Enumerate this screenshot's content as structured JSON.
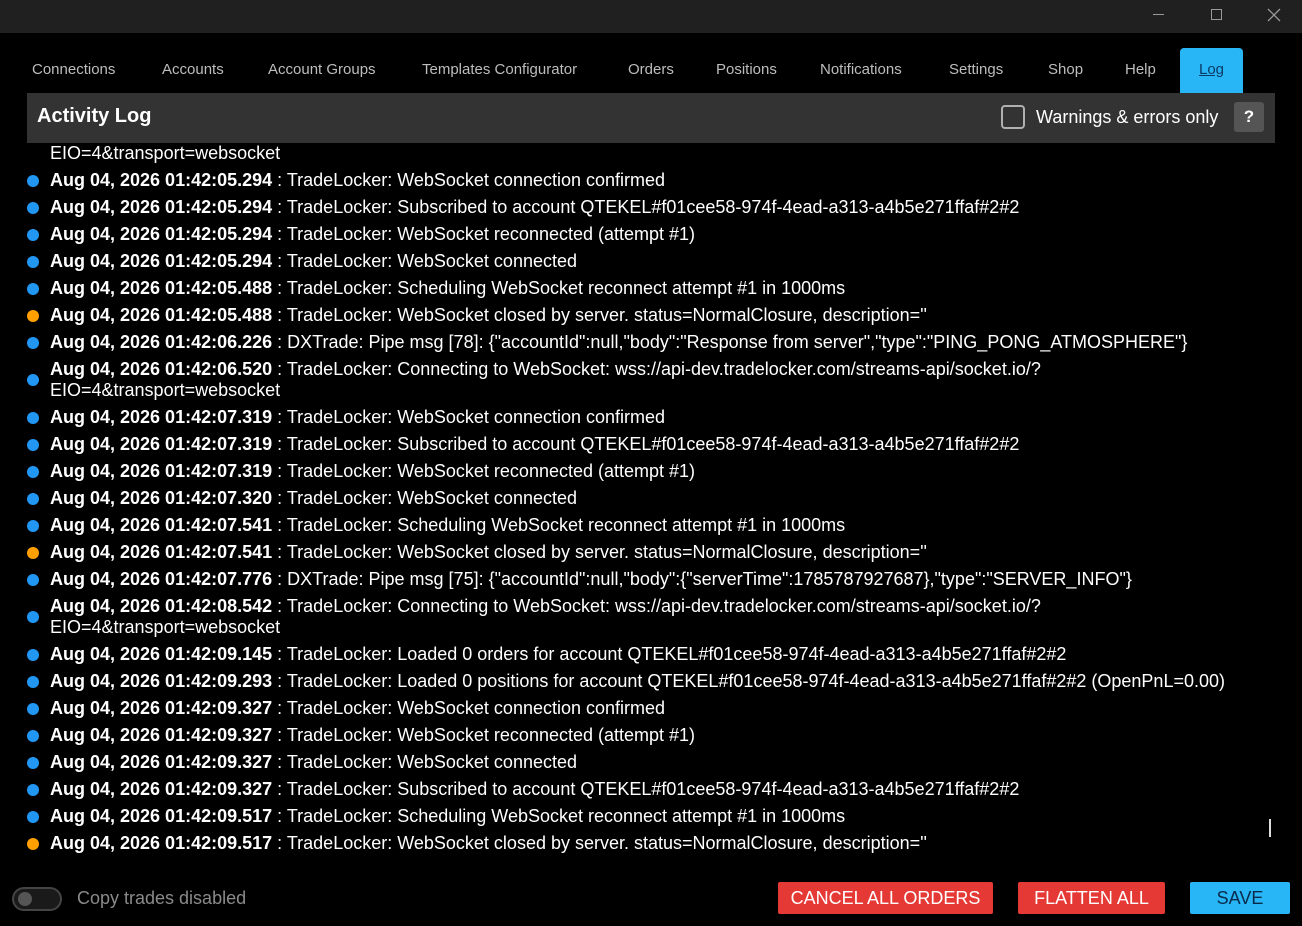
{
  "tabs": [
    {
      "label": "Connections"
    },
    {
      "label": "Accounts"
    },
    {
      "label": "Account Groups"
    },
    {
      "label": "Templates Configurator"
    },
    {
      "label": "Orders"
    },
    {
      "label": "Positions"
    },
    {
      "label": "Notifications"
    },
    {
      "label": "Settings"
    },
    {
      "label": "Shop"
    },
    {
      "label": "Help"
    },
    {
      "label": "Log"
    }
  ],
  "header": {
    "title": "Activity Log",
    "filter_label": "Warnings & errors only",
    "help_label": "?"
  },
  "colors": {
    "info_dot": "#2196f3",
    "warn_dot": "#ffa000",
    "accent": "#29b6f6",
    "danger": "#e53935"
  },
  "log": {
    "entries": [
      {
        "level": "cont",
        "ts": "",
        "msg": "EIO=4&transport=websocket"
      },
      {
        "level": "info",
        "ts": "Aug 04, 2026 01:42:05.294",
        "msg": " : TradeLocker: WebSocket connection confirmed"
      },
      {
        "level": "info",
        "ts": "Aug 04, 2026 01:42:05.294",
        "msg": " : TradeLocker: Subscribed to account QTEKEL#f01cee58-974f-4ead-a313-a4b5e271ffaf#2#2"
      },
      {
        "level": "info",
        "ts": "Aug 04, 2026 01:42:05.294",
        "msg": " : TradeLocker: WebSocket reconnected (attempt #1)"
      },
      {
        "level": "info",
        "ts": "Aug 04, 2026 01:42:05.294",
        "msg": " : TradeLocker: WebSocket connected"
      },
      {
        "level": "info",
        "ts": "Aug 04, 2026 01:42:05.488",
        "msg": " : TradeLocker: Scheduling WebSocket reconnect attempt #1 in 1000ms"
      },
      {
        "level": "warn",
        "ts": "Aug 04, 2026 01:42:05.488",
        "msg": " : TradeLocker: WebSocket closed by server. status=NormalClosure, description=''"
      },
      {
        "level": "info",
        "ts": "Aug 04, 2026 01:42:06.226",
        "msg": " : DXTrade: Pipe msg [78]: {\"accountId\":null,\"body\":\"Response from server\",\"type\":\"PING_PONG_ATMOSPHERE\"}"
      },
      {
        "level": "info-wrap",
        "ts": "Aug 04, 2026 01:42:06.520",
        "msg": " : TradeLocker: Connecting to WebSocket: wss://api-dev.tradelocker.com/streams-api/socket.io/? EIO=4&transport=websocket"
      },
      {
        "level": "info",
        "ts": "Aug 04, 2026 01:42:07.319",
        "msg": " : TradeLocker: WebSocket connection confirmed"
      },
      {
        "level": "info",
        "ts": "Aug 04, 2026 01:42:07.319",
        "msg": " : TradeLocker: Subscribed to account QTEKEL#f01cee58-974f-4ead-a313-a4b5e271ffaf#2#2"
      },
      {
        "level": "info",
        "ts": "Aug 04, 2026 01:42:07.319",
        "msg": " : TradeLocker: WebSocket reconnected (attempt #1)"
      },
      {
        "level": "info",
        "ts": "Aug 04, 2026 01:42:07.320",
        "msg": " : TradeLocker: WebSocket connected"
      },
      {
        "level": "info",
        "ts": "Aug 04, 2026 01:42:07.541",
        "msg": " : TradeLocker: Scheduling WebSocket reconnect attempt #1 in 1000ms"
      },
      {
        "level": "warn",
        "ts": "Aug 04, 2026 01:42:07.541",
        "msg": " : TradeLocker: WebSocket closed by server. status=NormalClosure, description=''"
      },
      {
        "level": "info",
        "ts": "Aug 04, 2026 01:42:07.776",
        "msg": " : DXTrade: Pipe msg [75]: {\"accountId\":null,\"body\":{\"serverTime\":1785787927687},\"type\":\"SERVER_INFO\"}"
      },
      {
        "level": "info-wrap",
        "ts": "Aug 04, 2026 01:42:08.542",
        "msg": " : TradeLocker: Connecting to WebSocket: wss://api-dev.tradelocker.com/streams-api/socket.io/? EIO=4&transport=websocket"
      },
      {
        "level": "info",
        "ts": "Aug 04, 2026 01:42:09.145",
        "msg": " : TradeLocker: Loaded 0 orders for account QTEKEL#f01cee58-974f-4ead-a313-a4b5e271ffaf#2#2"
      },
      {
        "level": "info",
        "ts": "Aug 04, 2026 01:42:09.293",
        "msg": " : TradeLocker: Loaded 0 positions for account QTEKEL#f01cee58-974f-4ead-a313-a4b5e271ffaf#2#2 (OpenPnL=0.00)"
      },
      {
        "level": "info",
        "ts": "Aug 04, 2026 01:42:09.327",
        "msg": " : TradeLocker: WebSocket connection confirmed"
      },
      {
        "level": "info",
        "ts": "Aug 04, 2026 01:42:09.327",
        "msg": " : TradeLocker: WebSocket reconnected (attempt #1)"
      },
      {
        "level": "info",
        "ts": "Aug 04, 2026 01:42:09.327",
        "msg": " : TradeLocker: WebSocket connected"
      },
      {
        "level": "info",
        "ts": "Aug 04, 2026 01:42:09.327",
        "msg": " : TradeLocker: Subscribed to account QTEKEL#f01cee58-974f-4ead-a313-a4b5e271ffaf#2#2"
      },
      {
        "level": "info",
        "ts": "Aug 04, 2026 01:42:09.517",
        "msg": " : TradeLocker: Scheduling WebSocket reconnect attempt #1 in 1000ms"
      },
      {
        "level": "warn",
        "ts": "Aug 04, 2026 01:42:09.517",
        "msg": " : TradeLocker: WebSocket closed by server. status=NormalClosure, description=''"
      }
    ]
  },
  "footer": {
    "copy_trades_label": "Copy trades disabled",
    "cancel_all_label": "CANCEL ALL ORDERS",
    "flatten_all_label": "FLATTEN ALL",
    "save_label": "SAVE"
  }
}
